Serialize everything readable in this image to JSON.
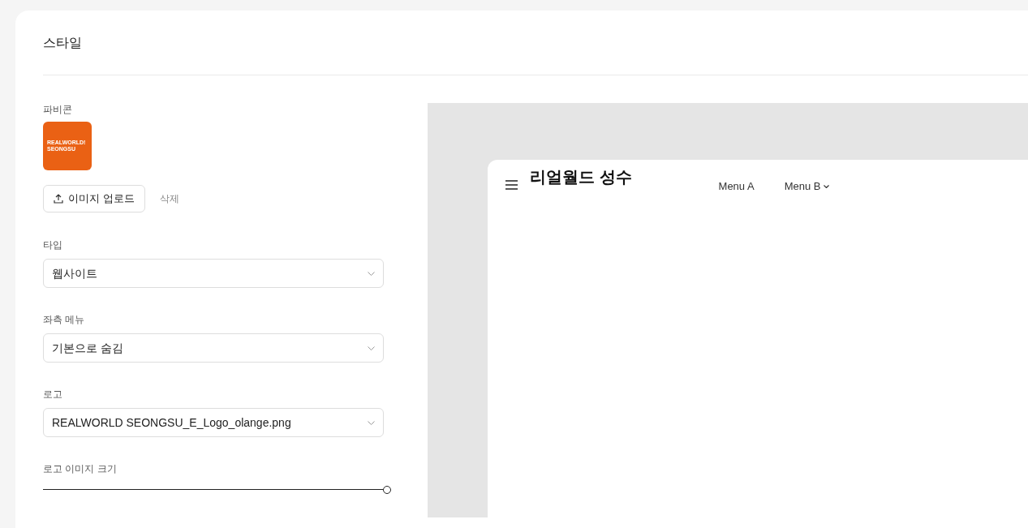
{
  "page": {
    "title": "스타일"
  },
  "favicon": {
    "label": "파비콘",
    "logo_lines": [
      "REALWORLD!",
      "SEONGSU"
    ],
    "upload_button": "이미지 업로드",
    "delete_button": "삭제"
  },
  "fields": [
    {
      "label": "타입",
      "value": "웹사이트"
    },
    {
      "label": "좌측 메뉴",
      "value": "기본으로 숨김"
    },
    {
      "label": "로고",
      "value": "REALWORLD SEONGSU_E_Logo_olange.png"
    }
  ],
  "logo_size": {
    "label": "로고 이미지 크기",
    "level": 1
  },
  "preview": {
    "site_title": "리얼월드 성수",
    "menu": [
      {
        "label": "Menu A",
        "has_dropdown": false
      },
      {
        "label": "Menu B",
        "has_dropdown": true
      }
    ]
  }
}
